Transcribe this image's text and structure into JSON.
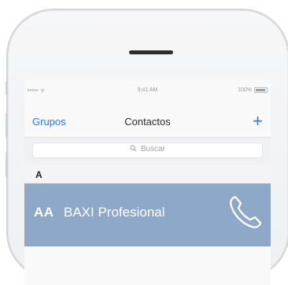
{
  "status_bar": {
    "signal": "•••••  ᯤ",
    "time": "9:41 AM",
    "battery_percent": "100%"
  },
  "nav": {
    "back_label": "Grupos",
    "title": "Contactos",
    "add_label": "+"
  },
  "search": {
    "placeholder": "Buscar"
  },
  "sections": [
    {
      "letter": "A",
      "contacts": [
        {
          "initials": "AA",
          "name": "BAXI Profesional"
        }
      ]
    }
  ],
  "colors": {
    "accent": "#2b78ec",
    "contact_row": "#8ea8c8"
  }
}
